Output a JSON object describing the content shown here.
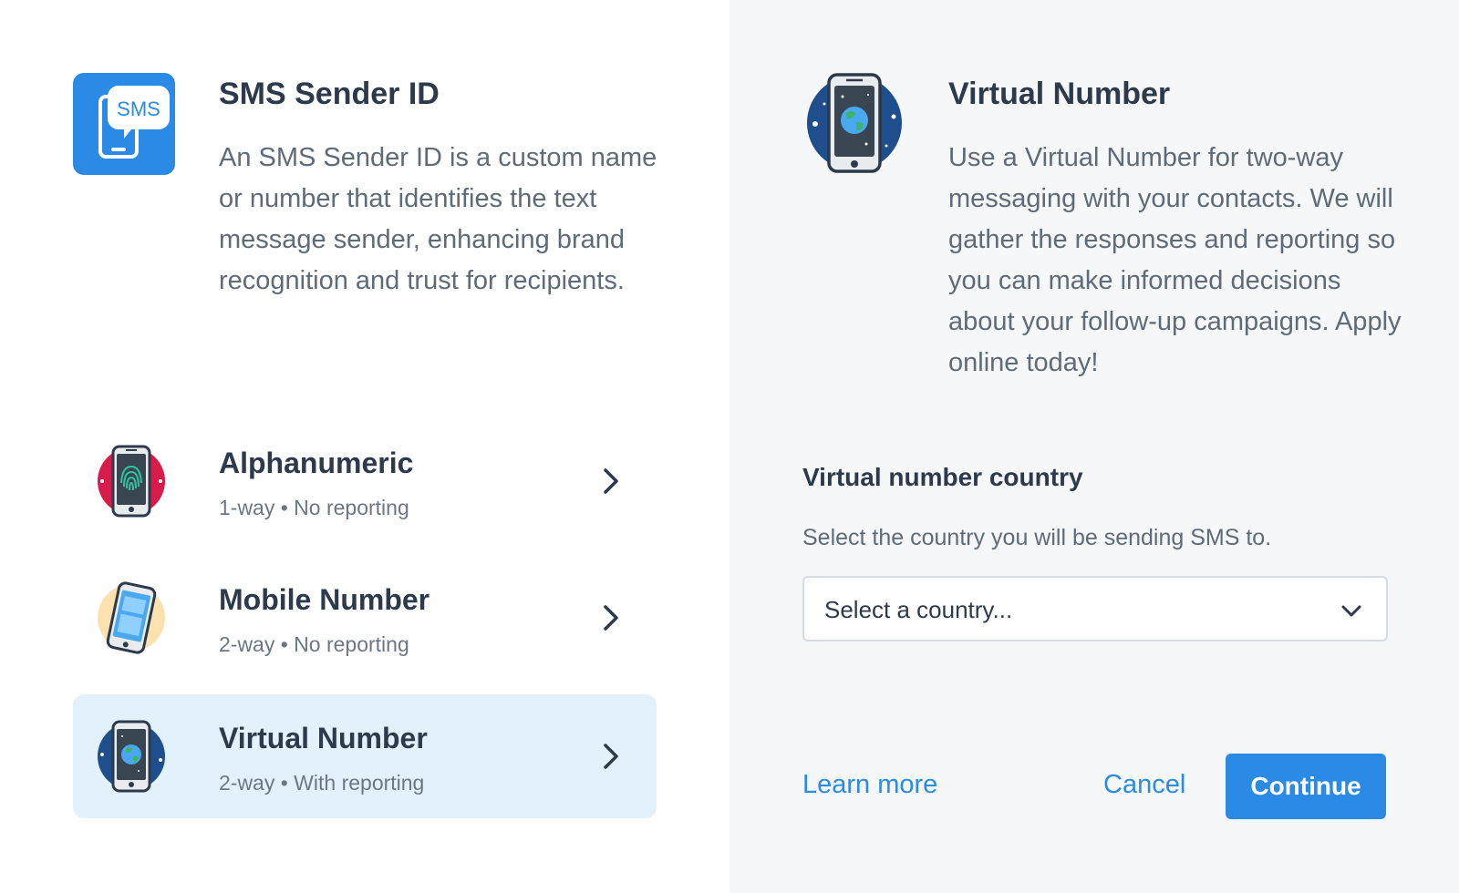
{
  "sender_id": {
    "title": "SMS Sender ID",
    "description": "An SMS Sender ID is a custom name or number that identifies the text message sender, enhancing brand recognition and trust for recipients.",
    "badge_text": "SMS"
  },
  "options": [
    {
      "title": "Alphanumeric",
      "subtitle": "1-way • No reporting",
      "icon": "fingerprint-phone-icon",
      "selected": false
    },
    {
      "title": "Mobile Number",
      "subtitle": "2-way • No reporting",
      "icon": "mobile-phone-icon",
      "selected": false
    },
    {
      "title": "Virtual Number",
      "subtitle": "2-way • With reporting",
      "icon": "globe-phone-icon",
      "selected": true
    }
  ],
  "detail": {
    "title": "Virtual Number",
    "description": "Use a Virtual Number for two-way messaging with your contacts. We will gather the responses and reporting so you can make informed decisions about your follow-up campaigns. Apply online today!",
    "icon": "globe-phone-icon"
  },
  "country_field": {
    "label": "Virtual number country",
    "help": "Select the country you will be sending SMS to.",
    "selected_value": "Select a country..."
  },
  "actions": {
    "learn_more": "Learn more",
    "cancel": "Cancel",
    "continue": "Continue"
  },
  "colors": {
    "accent": "#2a8ae6",
    "selected_bg": "#e3f1fd",
    "right_panel_bg": "#f5f7f9",
    "heading": "#2d3a4b",
    "body_text": "#5e6b78"
  }
}
